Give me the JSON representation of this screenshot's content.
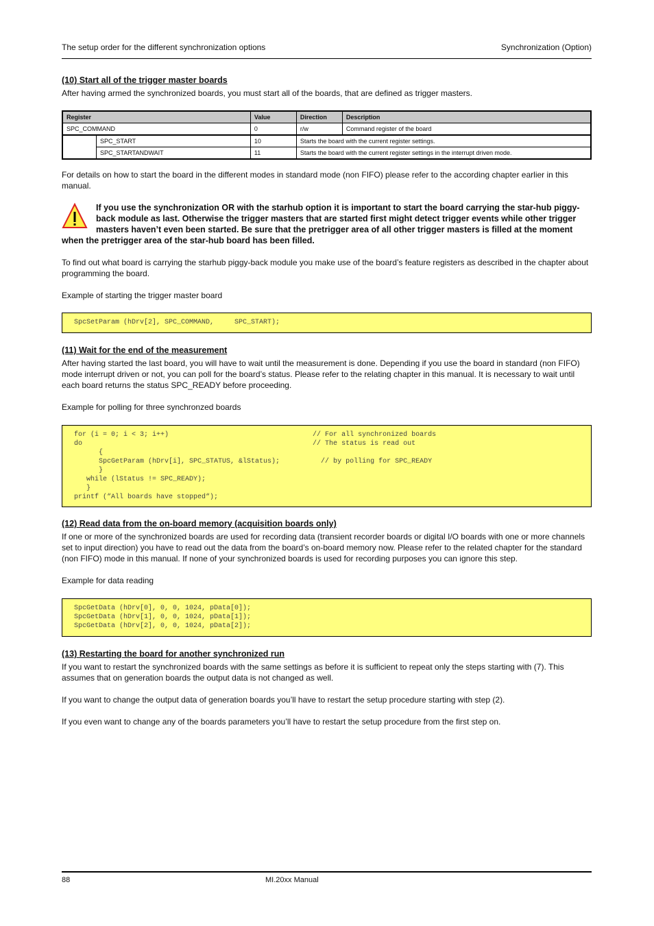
{
  "header": {
    "left": "The setup order for the different synchronization options",
    "right": "Synchronization (Option)"
  },
  "section10": {
    "heading": "(10) Start all of the trigger master boards",
    "intro": "After having armed the synchronized boards, you must start all of the boards, that are defined as trigger masters.",
    "table": {
      "headers": [
        "Register",
        "Value",
        "Direction",
        "Description"
      ],
      "main_row": {
        "register": "SPC_COMMAND",
        "value": "0",
        "direction": "r/w",
        "description": "Command register of the board"
      },
      "sub_rows": [
        {
          "register": "SPC_START",
          "value": "10",
          "description": "Starts the board with the current register settings."
        },
        {
          "register": "SPC_STARTANDWAIT",
          "value": "11",
          "description": "Starts the board with the current register settings in the interrupt driven mode."
        }
      ]
    },
    "details": "For details on how to start the board in the different modes in standard mode (non FIFO) please refer to the according chapter earlier in this manual.",
    "warning": "If you use the synchronization OR with the starhub option it is important to start the board carrying the star-hub piggy-back module as last. Otherwise the trigger masters that are started first might detect trigger events while other trigger masters haven’t even been started. Be sure that the pretrigger area of all other trigger masters is filled at the moment when the pretrigger area of the star-hub board has been filled.",
    "find_out": "To find out what board is carrying the starhub piggy-back module you make use of the board’s feature registers as described in the chapter about programming the board.",
    "example_label": "Example of starting the trigger master board",
    "code": "SpcSetParam (hDrv[2], SPC_COMMAND,     SPC_START);"
  },
  "section11": {
    "heading": "(11) Wait for the end of the measurement",
    "intro": "After having started the last board, you will have to wait until the measurement is done. Depending if you use the board in standard (non FIFO) mode interrupt driven or not, you can poll for the board’s status. Please refer to the relating chapter in this manual. It is necessary to wait until each board returns the status SPC_READY before proceeding.",
    "example_label": "Example for polling for three synchronzed boards",
    "code": "for (i = 0; i < 3; i++)                                   // For all synchronized boards\ndo                                                        // The status is read out\n      {\n      SpcGetParam (hDrv[i], SPC_STATUS, &lStatus);          // by polling for SPC_READY\n      }\n   while (lStatus != SPC_READY);\n   }\nprintf (“All boards have stopped“);"
  },
  "section12": {
    "heading": "(12) Read data from the on-board memory (acquisition boards only)",
    "intro": "If one or more of the synchronized boards are used for recording data (transient recorder boards or digital I/O boards with one or more channels set to input direction) you have to read out the data from the board’s on-board memory now. Please refer to the related chapter for the standard (non FIFO) mode in this manual. If none of your synchronized boards is used for recording purposes you can ignore this step.",
    "example_label": "Example for data reading",
    "code": "SpcGetData (hDrv[0], 0, 0, 1024, pData[0]);\nSpcGetData (hDrv[1], 0, 0, 1024, pData[1]);\nSpcGetData (hDrv[2], 0, 0, 1024, pData[2]);"
  },
  "section13": {
    "heading": "(13) Restarting the board for another synchronized run",
    "p1": "If you want to restart the synchronized boards with the same settings as before it is sufficient to repeat only the steps starting with (7). This assumes that on generation boards the output data is not changed as well.",
    "p2": "If you want to change the output data of generation boards you’ll have to restart the setup procedure starting with step (2).",
    "p3": "If you even want to change any of the boards parameters you’ll have to restart the setup procedure from the first step on."
  },
  "footer": {
    "page_number": "88",
    "manual": "MI.20xx Manual"
  },
  "colors": {
    "code_background": "#ffff80",
    "table_header": "#c8c8c8",
    "warning_yellow": "#ffee44",
    "warning_red": "#dd2222"
  }
}
